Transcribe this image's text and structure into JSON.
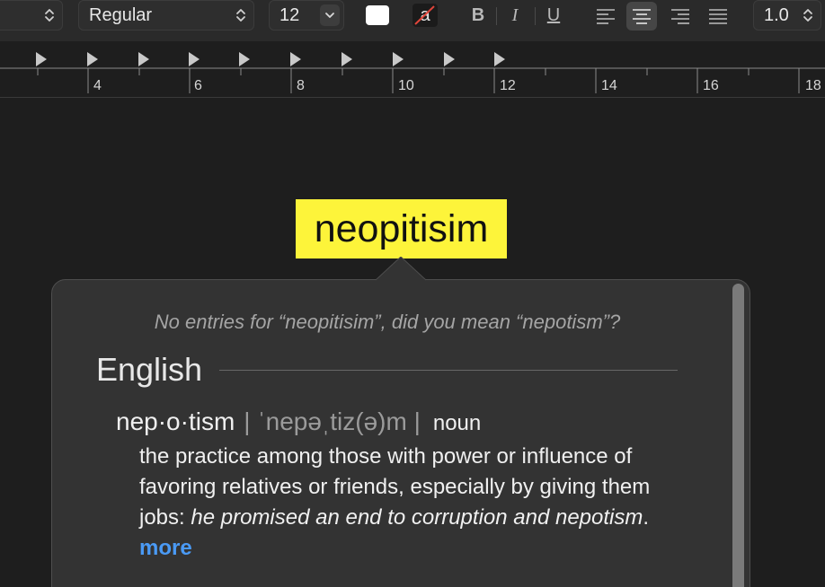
{
  "toolbar": {
    "style_select": {
      "value": "Regular"
    },
    "size_select": {
      "value": "12"
    },
    "text_color_sample": "a",
    "bold_label": "B",
    "italic_label": "I",
    "underline_label": "U",
    "line_spacing_select": {
      "value": "1.0"
    },
    "active_alignment": "center"
  },
  "ruler": {
    "labels": [
      "4",
      "6",
      "8",
      "10",
      "12",
      "14",
      "16",
      "18"
    ]
  },
  "document": {
    "word": "neopitisim",
    "highlight_color": "#fdf43a"
  },
  "lookup": {
    "no_entries_message": "No entries for “neopitisim”, did you mean “nepotism”?",
    "section_title": "English",
    "headword": "nep·o·tism",
    "pronunciation": "| ˈnepəˌtiz(ə)m |",
    "part_of_speech": "noun",
    "definition_text": "the practice among those with power or influence of favoring relatives or friends, especially by giving them jobs:",
    "example": "he promised an end to corruption and nepotism",
    "example_end": ".",
    "more_label": "more",
    "link_color": "#4a9af5"
  }
}
